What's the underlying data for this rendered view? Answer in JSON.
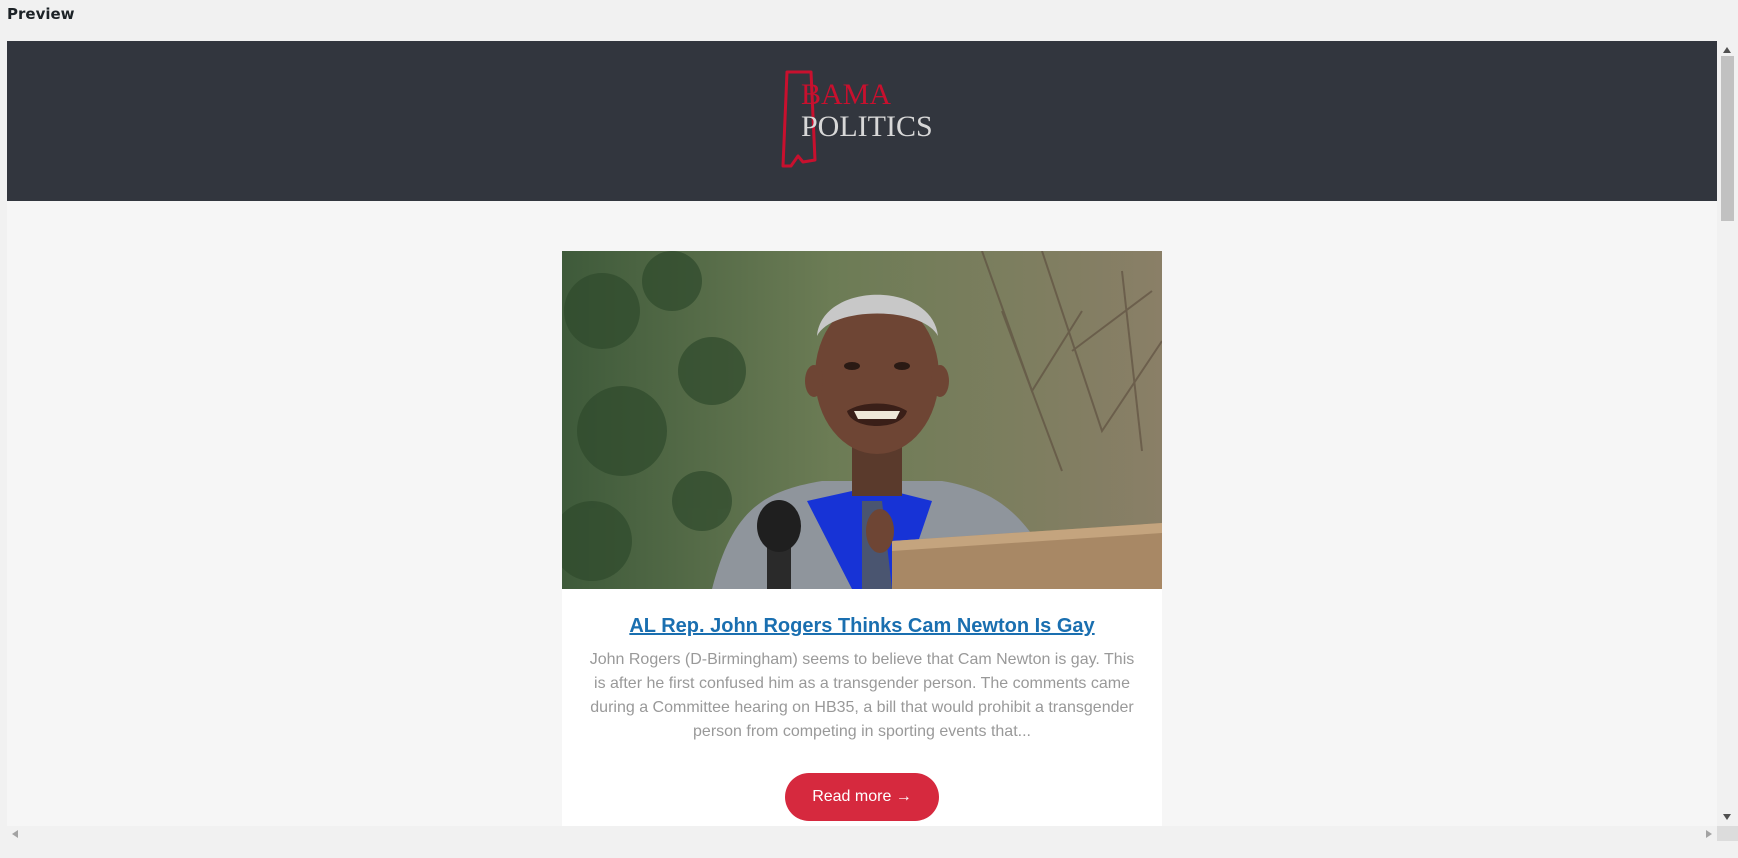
{
  "preview": {
    "label": "Preview"
  },
  "header": {
    "logo": {
      "line1": "BAMA",
      "line2": "POLITICS",
      "icon": "alabama-state-outline-icon"
    },
    "background": "#32363e",
    "accent": "#c8102e"
  },
  "article": {
    "image_alt": "Man in gray blazer and blue shirt speaking at a wooden podium with a microphone",
    "title": "AL Rep. John Rogers Thinks Cam Newton Is Gay",
    "excerpt": "John Rogers (D-Birmingham) seems to believe that Cam Newton is gay. This is after he first confused him as a transgender person. The comments came during a Committee hearing on HB35, a bill that would prohibit a transgender person from competing in sporting events that...",
    "read_more_label": "Read more →",
    "title_color": "#1a6fb0",
    "button_color": "#d6293e"
  }
}
